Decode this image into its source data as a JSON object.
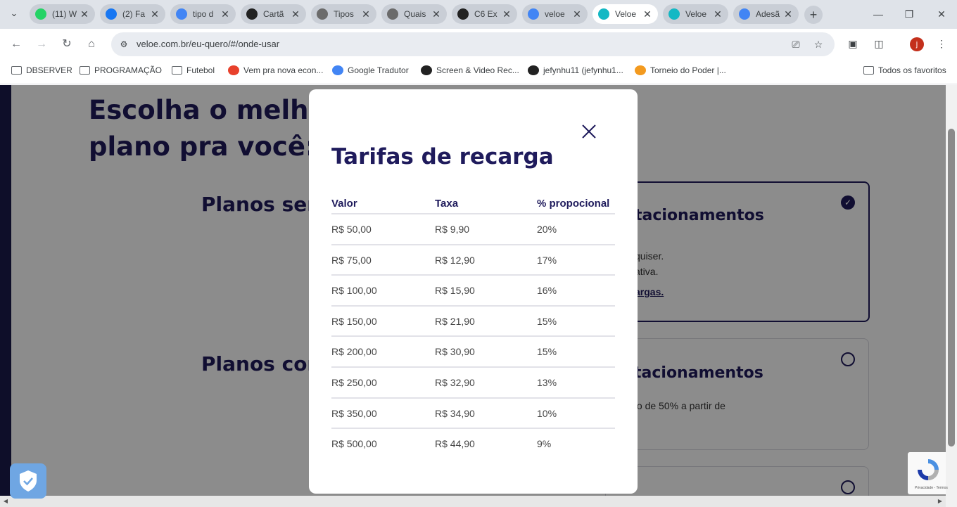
{
  "browser": {
    "tabs": [
      {
        "title": "(11) W",
        "icon": "whatsapp-icon",
        "color": "#25d366",
        "active": false
      },
      {
        "title": "(2) Fa",
        "icon": "facebook-icon",
        "color": "#1877f2",
        "active": false
      },
      {
        "title": "tipo d",
        "icon": "google-icon",
        "color": "#4285f4",
        "active": false
      },
      {
        "title": "Cartã",
        "icon": "c6-icon",
        "color": "#222222",
        "active": false
      },
      {
        "title": "Tipos",
        "icon": "globe-icon",
        "color": "#6b6b6b",
        "active": false
      },
      {
        "title": "Quais",
        "icon": "globe-icon",
        "color": "#6b6b6b",
        "active": false
      },
      {
        "title": "C6 Ex",
        "icon": "c6-icon",
        "color": "#222222",
        "active": false
      },
      {
        "title": "veloe",
        "icon": "google-icon",
        "color": "#4285f4",
        "active": false
      },
      {
        "title": "Veloe",
        "icon": "veloe-icon",
        "color": "#14b8c4",
        "active": true
      },
      {
        "title": "Veloe",
        "icon": "veloe-icon",
        "color": "#14b8c4",
        "active": false
      },
      {
        "title": "Adesã",
        "icon": "google-icon",
        "color": "#4285f4",
        "active": false
      }
    ],
    "url": "veloe.com.br/eu-quero/#/onde-usar",
    "profile_initial": "j",
    "bookmarks": [
      {
        "label": "DBSERVER",
        "icon": "folder-icon"
      },
      {
        "label": "PROGRAMAÇÃO",
        "icon": "folder-icon"
      },
      {
        "label": "Futebol",
        "icon": "folder-icon"
      },
      {
        "label": "Vem pra nova econ...",
        "icon": "mb-icon"
      },
      {
        "label": "Google Tradutor",
        "icon": "translate-icon"
      },
      {
        "label": "Screen & Video Rec...",
        "icon": "record-icon"
      },
      {
        "label": "jefynhu11 (jefynhu1...",
        "icon": "github-icon"
      },
      {
        "label": "Torneio do Poder |...",
        "icon": "dragonball-icon"
      }
    ],
    "all_bookmarks": "Todos os favoritos"
  },
  "page": {
    "heading_line1": "Escolha o melhor",
    "heading_line2": "plano pra você:",
    "section1": "Planos sem",
    "section2": "Planos com",
    "card1": {
      "title": "tacionamentos",
      "line1": "quiser.",
      "line2": "ativa.",
      "link": "argas."
    },
    "card2": {
      "title": "tacionamentos",
      "line1": "to de 50% a partir de"
    },
    "recaptcha_text": "Privacidade - Termos"
  },
  "modal": {
    "title": "Tarifas de recarga",
    "headers": [
      "Valor",
      "Taxa",
      "% propocional"
    ],
    "rows": [
      [
        "R$ 50,00",
        "R$ 9,90",
        "20%"
      ],
      [
        "R$ 75,00",
        "R$ 12,90",
        "17%"
      ],
      [
        "R$ 100,00",
        "R$ 15,90",
        "16%"
      ],
      [
        "R$ 150,00",
        "R$ 21,90",
        "15%"
      ],
      [
        "R$ 200,00",
        "R$ 30,90",
        "15%"
      ],
      [
        "R$ 250,00",
        "R$ 32,90",
        "13%"
      ],
      [
        "R$ 350,00",
        "R$ 34,90",
        "10%"
      ],
      [
        "R$ 500,00",
        "R$ 44,90",
        "9%"
      ]
    ]
  }
}
